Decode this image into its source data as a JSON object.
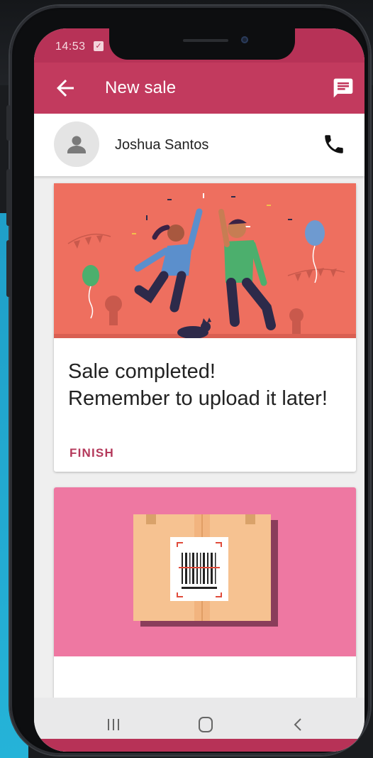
{
  "status_bar": {
    "time": "14:53",
    "notification_icon": "checkbox-notification-icon"
  },
  "app_bar": {
    "title": "New sale",
    "back_icon": "arrow-back-icon",
    "action_icon": "chat-icon",
    "color": "#c23a5e"
  },
  "contact": {
    "name": "Joshua Santos",
    "avatar_icon": "person-icon",
    "call_icon": "phone-icon"
  },
  "cards": [
    {
      "illustration": "celebration-illustration",
      "message_line1": "Sale completed!",
      "message_line2": "Remember to upload it later!",
      "action_label": "FINISH",
      "accent": "#b4395b"
    },
    {
      "illustration": "barcode-box-illustration"
    }
  ],
  "nav_bar": {
    "recents_icon": "recents-icon",
    "home_icon": "home-icon",
    "back_icon": "back-chevron-icon"
  }
}
